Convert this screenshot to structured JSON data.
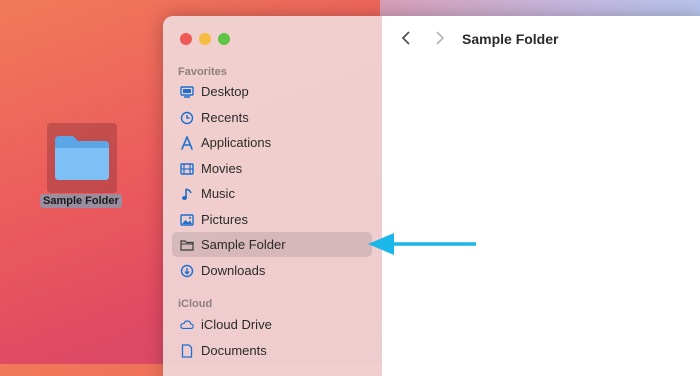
{
  "desktop": {
    "folder_label": "Sample Folder"
  },
  "window": {
    "title": "Sample Folder",
    "sidebar": {
      "favorites_header": "Favorites",
      "favorites": [
        {
          "label": "Desktop",
          "icon": "desktop-icon"
        },
        {
          "label": "Recents",
          "icon": "clock-icon"
        },
        {
          "label": "Applications",
          "icon": "applications-icon"
        },
        {
          "label": "Movies",
          "icon": "film-icon"
        },
        {
          "label": "Music",
          "icon": "music-note-icon"
        },
        {
          "label": "Pictures",
          "icon": "photo-icon"
        },
        {
          "label": "Sample Folder",
          "icon": "folder-icon",
          "selected": true
        },
        {
          "label": "Downloads",
          "icon": "download-icon"
        }
      ],
      "icloud_header": "iCloud",
      "icloud": [
        {
          "label": "iCloud Drive",
          "icon": "cloud-icon"
        },
        {
          "label": "Documents",
          "icon": "document-icon"
        }
      ]
    }
  },
  "colors": {
    "accent": "#1a6fd0",
    "arrow": "#1ab7e8",
    "sidebar_bg": "#f0d7d7"
  }
}
